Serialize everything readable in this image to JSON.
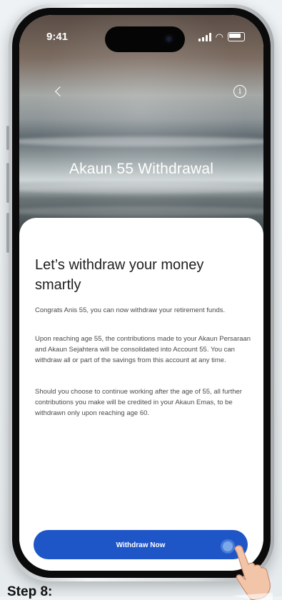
{
  "status_bar": {
    "time": "9:41"
  },
  "header": {
    "title": "Akaun 55 Withdrawal"
  },
  "content": {
    "heading": "Let’s withdraw your money smartly",
    "paragraphs": [
      "Congrats Anis 55, you can now withdraw your retirement funds.",
      "Upon reaching age 55, the contributions made to your Akaun Persaraan and Akaun Sejahtera will be consolidated into Account 55. You can withdraw all or part of the savings from this account at any time.",
      "Should you choose to continue working after the age of 55, all further contributions you make will be credited in your Akaun Emas, to be withdrawn only upon reaching age 60."
    ]
  },
  "actions": {
    "primary_label": "Withdraw Now"
  },
  "caption": {
    "text": "Step 8:"
  },
  "colors": {
    "accent": "#1e56c8",
    "sheet": "#ffffff"
  },
  "icons": [
    "back-icon",
    "info-icon",
    "signal-icon",
    "wifi-icon",
    "battery-icon",
    "hand-pointer-icon"
  ]
}
